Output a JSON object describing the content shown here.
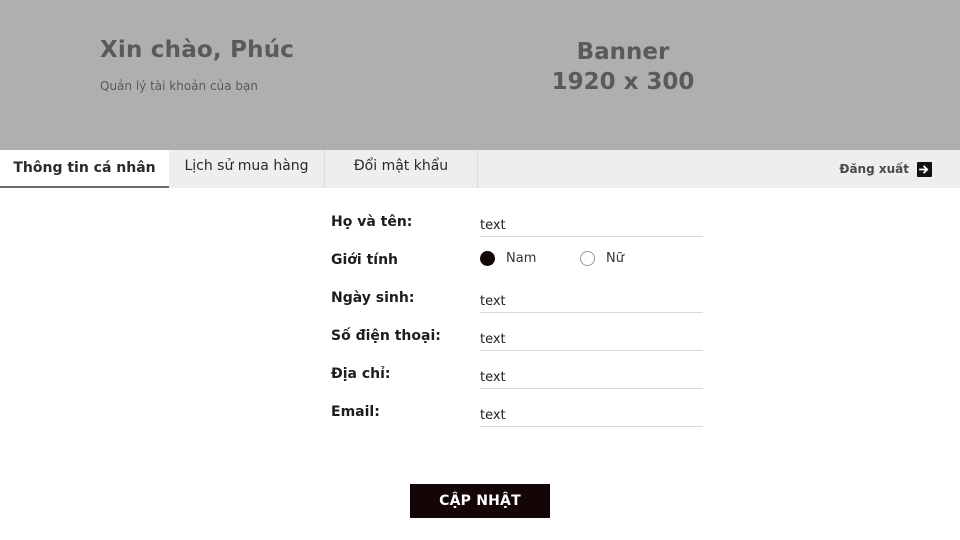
{
  "header": {
    "greeting": "Xin chào, Phúc",
    "subtitle": "Quản lý tài khoản của bạn",
    "banner_line1": "Banner",
    "banner_line2": "1920 x 300"
  },
  "tabs": [
    {
      "label": "Thông tin cá nhân",
      "active": true
    },
    {
      "label": "Lịch sử mua hàng",
      "active": false
    },
    {
      "label": "Đổi mật khẩu",
      "active": false
    }
  ],
  "logout": {
    "label": "Đăng xuất",
    "icon": "logout-icon"
  },
  "form": {
    "fullname": {
      "label": "Họ và tên:",
      "value": "text"
    },
    "gender": {
      "label": "Giới tính",
      "options": [
        {
          "label": "Nam",
          "checked": true
        },
        {
          "label": "Nữ",
          "checked": false
        }
      ]
    },
    "birthday": {
      "label": "Ngày sinh:",
      "value": "text"
    },
    "phone": {
      "label": "Số điện thoại:",
      "value": "text"
    },
    "address": {
      "label": "Địa chỉ:",
      "value": "text"
    },
    "email": {
      "label": "Email:",
      "value": "text"
    }
  },
  "submit_label": "CẬP NHẬT",
  "colors": {
    "banner_bg": "#afafaf",
    "tabbar_bg": "#efeeec",
    "button_bg": "#140606",
    "radio_checked": "#120808"
  }
}
